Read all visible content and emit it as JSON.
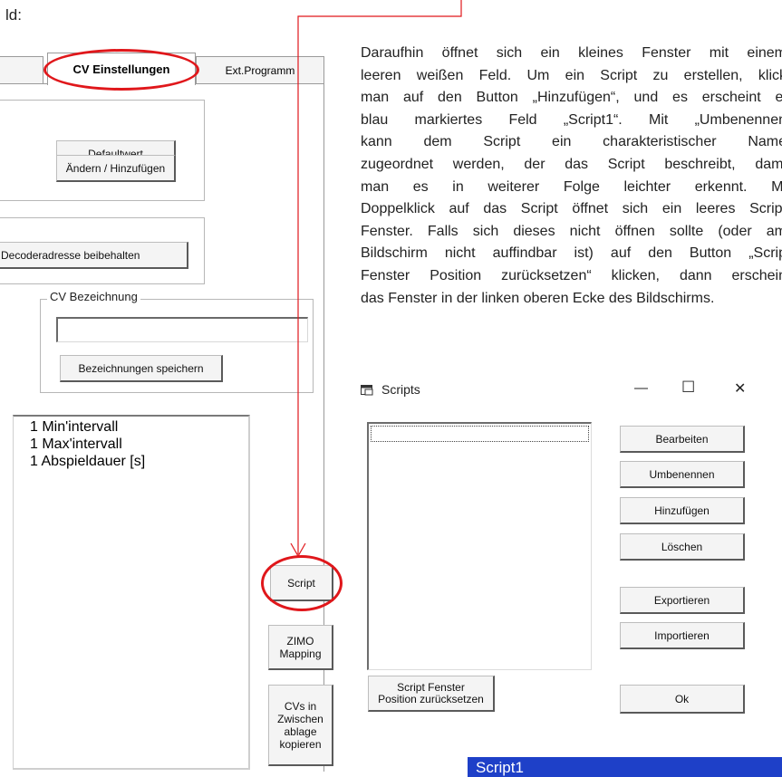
{
  "top_left_fragment": "ld:",
  "left_panel": {
    "tabs": [
      {
        "label": ""
      },
      {
        "label": "CV Einstellungen"
      },
      {
        "label": "Ext.Programm"
      }
    ],
    "buttons": {
      "defaultwert": "Defaultwert",
      "aendern": "Ändern / Hinzufügen",
      "decoderadresse": "Decoderadresse beibehalten",
      "bezeichnungen": "Bezeichnungen speichern",
      "script": "Script",
      "zimo": "ZIMO\nMapping",
      "cvs": "CVs in\nZwischen\nablage\nkopieren"
    },
    "cv_bezeichnung_label": "CV Bezeichnung",
    "cv_bezeichnung_value": "",
    "list_items": [
      "1 Min'intervall",
      "1 Max'intervall",
      "1 Abspieldauer [s]"
    ]
  },
  "paragraph": [
    "Daraufhin öffnet sich ein kleines Fenster mit einem",
    "leeren weißen Feld. Um ein Script zu erstellen, klick",
    "man auf den Button „Hinzufügen“, und es erscheint ei",
    "blau markiertes Feld „Script1“. Mit „Umbenennen",
    "kann dem Script ein charakteristischer Name",
    "zugeordnet werden, der das Script beschreibt, dami",
    "man es in weiterer Folge leichter erkennt. Mi",
    "Doppelklick auf das Script öffnet sich ein leeres Script",
    "Fenster. Falls sich dieses nicht öffnen sollte (oder am",
    "Bildschirm nicht auffindbar ist) auf den Button „Scrip",
    "Fenster Position zurücksetzen“ klicken, dann erschein",
    "das Fenster in der linken oberen Ecke des Bildschirms."
  ],
  "scripts_window": {
    "title": "Scripts",
    "controls": {
      "minimize": "—",
      "maximize": "☐",
      "close": "✕"
    },
    "list_value": "",
    "buttons": {
      "bearbeiten": "Bearbeiten",
      "umbenennen": "Umbenennen",
      "hinzufuegen": "Hinzufügen",
      "loeschen": "Löschen",
      "exportieren": "Exportieren",
      "importieren": "Importieren",
      "reset": "Script Fenster\nPosition zurücksetzen",
      "ok": "Ok"
    }
  },
  "script1_label": "Script1",
  "colors": {
    "annotation_red": "#e0171b",
    "selection_blue": "#1e40c8"
  }
}
